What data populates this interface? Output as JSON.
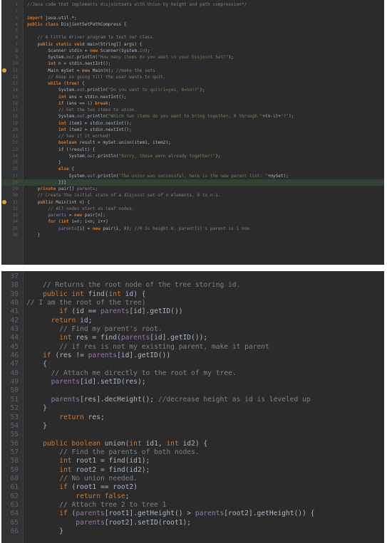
{
  "panels": [
    {
      "name": "editor-top",
      "lines": [
        {
          "n": "1",
          "tokens": [
            [
              "com",
              "//Java code that implements "
            ],
            [
              "com",
              "disjointsets"
            ],
            [
              "com",
              " with Union by height and path compression*/"
            ]
          ]
        },
        {
          "n": "2",
          "tokens": []
        },
        {
          "n": "3",
          "tokens": [
            [
              "kw",
              "import "
            ],
            [
              "cls",
              "java.util.*"
            ],
            [
              "cls",
              ";"
            ]
          ]
        },
        {
          "n": "4",
          "tokens": [
            [
              "kw",
              "public class "
            ],
            [
              "cls",
              "DisjiontSetPathCompress {"
            ]
          ]
        },
        {
          "n": "5",
          "tokens": []
        },
        {
          "n": "6",
          "tokens": [
            [
              "com",
              "    // A little driver program to test our class."
            ]
          ]
        },
        {
          "n": "7",
          "fold": true,
          "tokens": [
            [
              "kw",
              "    public static void "
            ],
            [
              "cls",
              "main(String[] args) {"
            ]
          ]
        },
        {
          "n": "8",
          "tokens": [
            [
              "cls",
              "        Scanner stdin = "
            ],
            [
              "kw",
              "new "
            ],
            [
              "cls",
              "Scanner(System."
            ],
            [
              "ital",
              "in"
            ],
            [
              "cls",
              ");"
            ]
          ]
        },
        {
          "n": "9",
          "tokens": [
            [
              "cls",
              "        System."
            ],
            [
              "ital",
              "out"
            ],
            [
              "cls",
              ".println("
            ],
            [
              "str",
              "\"How many items do you want in your Disjoint Set?\""
            ],
            [
              "cls",
              ");"
            ]
          ]
        },
        {
          "n": "10",
          "tokens": [
            [
              "kw",
              "        int "
            ],
            [
              "cls",
              "n = stdin.nextInt();"
            ]
          ]
        },
        {
          "n": "11",
          "dot": true,
          "tokens": [
            [
              "cls",
              "        Main mySet = "
            ],
            [
              "kw",
              "new "
            ],
            [
              "cls",
              "Main(n); "
            ],
            [
              "com",
              "//make the sets"
            ]
          ]
        },
        {
          "n": "12",
          "tokens": [
            [
              "com",
              "        // Keep on going till the user wants to quit."
            ]
          ]
        },
        {
          "n": "13",
          "tokens": [
            [
              "kw",
              "        while "
            ],
            [
              "cls",
              "("
            ],
            [
              "kw",
              "true"
            ],
            [
              "cls",
              ") {"
            ]
          ]
        },
        {
          "n": "14",
          "tokens": [
            [
              "cls",
              "            System."
            ],
            [
              "ital",
              "out"
            ],
            [
              "cls",
              ".println("
            ],
            [
              "str",
              "\"Do you want to quit(1=yes, 0=no)?\""
            ],
            [
              "cls",
              ");"
            ]
          ]
        },
        {
          "n": "15",
          "tokens": [
            [
              "kw",
              "            int "
            ],
            [
              "cls",
              "ans = stdin.nextInt();"
            ]
          ]
        },
        {
          "n": "16",
          "tokens": [
            [
              "kw",
              "            if "
            ],
            [
              "cls",
              "(ans == "
            ],
            [
              "num",
              "1"
            ],
            [
              "cls",
              ") "
            ],
            [
              "kw",
              "break"
            ],
            [
              "cls",
              ";"
            ]
          ]
        },
        {
          "n": "17",
          "tokens": [
            [
              "com",
              "            // Get the two items to union."
            ]
          ]
        },
        {
          "n": "18",
          "tokens": [
            [
              "cls",
              "            System."
            ],
            [
              "ital",
              "out"
            ],
            [
              "cls",
              ".println("
            ],
            [
              "str",
              "\"Which two items do you want to bring together, 0 through \""
            ],
            [
              "cls",
              "+(n-"
            ],
            [
              "num",
              "1"
            ],
            [
              "cls",
              ")+"
            ],
            [
              "str",
              "\"?\""
            ],
            [
              "cls",
              ");"
            ]
          ]
        },
        {
          "n": "19",
          "tokens": [
            [
              "kw",
              "            int "
            ],
            [
              "cls",
              "item1 = stdin.nextInt();"
            ]
          ]
        },
        {
          "n": "20",
          "tokens": [
            [
              "kw",
              "            int "
            ],
            [
              "cls",
              "item2 = stdin.nextInt();"
            ]
          ]
        },
        {
          "n": "21",
          "tokens": [
            [
              "com",
              "            // See if it worked!"
            ]
          ]
        },
        {
          "n": "22",
          "tokens": [
            [
              "kw",
              "            boolean "
            ],
            [
              "cls",
              "result = mySet.union(item1, item2);"
            ]
          ]
        },
        {
          "n": "23",
          "tokens": [
            [
              "kw",
              "            if "
            ],
            [
              "cls",
              "(!result) {"
            ]
          ]
        },
        {
          "n": "24",
          "tokens": [
            [
              "cls",
              "                System."
            ],
            [
              "ital",
              "out"
            ],
            [
              "cls",
              ".println("
            ],
            [
              "str",
              "\"Sorry, those were already together!\""
            ],
            [
              "cls",
              ");"
            ]
          ]
        },
        {
          "n": "25",
          "tokens": [
            [
              "cls",
              "            }"
            ]
          ]
        },
        {
          "n": "26",
          "tokens": [
            [
              "kw",
              "            else "
            ],
            [
              "cls",
              "{"
            ]
          ]
        },
        {
          "n": "27",
          "tokens": [
            [
              "cls",
              "                System."
            ],
            [
              "ital",
              "out"
            ],
            [
              "cls",
              ".println("
            ],
            [
              "str",
              "\"The union was successful, here is the new parent list: \""
            ],
            [
              "cls",
              "+mySet);"
            ]
          ]
        },
        {
          "n": "28",
          "hl": true,
          "tokens": [
            [
              "cls",
              "            }}}"
            ]
          ]
        },
        {
          "n": "29",
          "tokens": [
            [
              "kw",
              "    private "
            ],
            [
              "cls",
              "pair[] "
            ],
            [
              "fld",
              "parents"
            ],
            [
              "cls",
              ";"
            ]
          ]
        },
        {
          "n": "30",
          "tokens": [
            [
              "com",
              "    // Create the initial state of a disjoint set of n elements, 0 to n-1."
            ]
          ]
        },
        {
          "n": "31",
          "dot": true,
          "fold": true,
          "tokens": [
            [
              "kw",
              "    public "
            ],
            [
              "cls",
              "Main(int n) {"
            ]
          ]
        },
        {
          "n": "32",
          "tokens": [
            [
              "com",
              "        // All nodes start as leaf nodes."
            ]
          ]
        },
        {
          "n": "33",
          "tokens": [
            [
              "fld",
              "        parents "
            ],
            [
              "cls",
              "= "
            ],
            [
              "kw",
              "new "
            ],
            [
              "cls",
              "pair[n];"
            ]
          ]
        },
        {
          "n": "34",
          "tokens": [
            [
              "kw",
              "        for "
            ],
            [
              "cls",
              "("
            ],
            [
              "kw",
              "int "
            ],
            [
              "cls",
              "i="
            ],
            [
              "num",
              "0"
            ],
            [
              "cls",
              "; i<n; i++)"
            ]
          ]
        },
        {
          "n": "35",
          "tokens": [
            [
              "fld",
              "            parents"
            ],
            [
              "cls",
              "[i] = "
            ],
            [
              "kw",
              "new "
            ],
            [
              "cls",
              "pair(i, "
            ],
            [
              "num",
              "0"
            ],
            [
              "cls",
              "); "
            ],
            [
              "com",
              "//0 is height 0. parent[i]'s parent is i now"
            ]
          ]
        },
        {
          "n": "36",
          "tokens": [
            [
              "cls",
              "    }"
            ]
          ]
        }
      ]
    },
    {
      "name": "editor-bottom",
      "lines": [
        {
          "n": "37",
          "tokens": []
        },
        {
          "n": "38",
          "tokens": [
            [
              "com",
              "    // Returns the root node of the tree storing id."
            ]
          ]
        },
        {
          "n": "39",
          "fold": true,
          "tokens": [
            [
              "kw2",
              "    public int "
            ],
            [
              "cls",
              "find("
            ],
            [
              "kw2",
              "int "
            ],
            [
              "cls",
              "id) {"
            ]
          ]
        },
        {
          "n": "40",
          "tokens": [
            [
              "com",
              "// I am the root of the tree)"
            ]
          ]
        },
        {
          "n": "41",
          "tokens": [
            [
              "kw2",
              "        if "
            ],
            [
              "cls",
              "(id == "
            ],
            [
              "fld",
              "parents"
            ],
            [
              "cls",
              "[id].getID())"
            ]
          ]
        },
        {
          "n": "42",
          "tokens": [
            [
              "kw2",
              "      return "
            ],
            [
              "cls",
              "id;"
            ]
          ]
        },
        {
          "n": "43",
          "tokens": [
            [
              "com",
              "        // Find my parent's root."
            ]
          ]
        },
        {
          "n": "44",
          "tokens": [
            [
              "kw2",
              "        int "
            ],
            [
              "cls",
              "res = find("
            ],
            [
              "fld",
              "parents"
            ],
            [
              "cls",
              "[id].getID());"
            ]
          ]
        },
        {
          "n": "45",
          "tokens": [
            [
              "com",
              "        // if res is not "
            ],
            [
              "com",
              "my"
            ],
            [
              "com",
              " existing parent, make it parent"
            ]
          ]
        },
        {
          "n": "46",
          "tokens": [
            [
              "kw2",
              "    if "
            ],
            [
              "cls",
              "(res != "
            ],
            [
              "fld",
              "parents"
            ],
            [
              "cls",
              "[id].getID())"
            ]
          ]
        },
        {
          "n": "47",
          "tokens": [
            [
              "cls",
              "    {"
            ]
          ]
        },
        {
          "n": "48",
          "tokens": [
            [
              "com",
              "      // Attach me directly to the root of my tree."
            ]
          ]
        },
        {
          "n": "49",
          "tokens": [
            [
              "fld",
              "      parents"
            ],
            [
              "cls",
              "[id].setID(res);"
            ]
          ]
        },
        {
          "n": "50",
          "tokens": []
        },
        {
          "n": "51",
          "tokens": [
            [
              "fld",
              "      parents"
            ],
            [
              "cls",
              "[res].decHeight(); "
            ],
            [
              "com",
              "//decrease height as id is leveled up"
            ]
          ]
        },
        {
          "n": "52",
          "tokens": [
            [
              "cls",
              "    }"
            ]
          ]
        },
        {
          "n": "53",
          "tokens": [
            [
              "kw2",
              "        return "
            ],
            [
              "cls",
              "res;"
            ]
          ]
        },
        {
          "n": "54",
          "tokens": [
            [
              "cls",
              "    }"
            ]
          ]
        },
        {
          "n": "55",
          "tokens": []
        },
        {
          "n": "56",
          "fold": true,
          "tokens": [
            [
              "kw2",
              "    public boolean "
            ],
            [
              "cls",
              "union("
            ],
            [
              "kw2",
              "int "
            ],
            [
              "cls",
              "id1, "
            ],
            [
              "kw2",
              "int "
            ],
            [
              "cls",
              "id2) {"
            ]
          ]
        },
        {
          "n": "57",
          "tokens": [
            [
              "com",
              "        // Find the parents of both nodes."
            ]
          ]
        },
        {
          "n": "58",
          "tokens": [
            [
              "kw2",
              "        int "
            ],
            [
              "cls",
              "root1 = find(id1);"
            ]
          ]
        },
        {
          "n": "59",
          "tokens": [
            [
              "kw2",
              "        int "
            ],
            [
              "cls",
              "root2 = find(id2);"
            ]
          ]
        },
        {
          "n": "60",
          "tokens": [
            [
              "com",
              "        // No union needed."
            ]
          ]
        },
        {
          "n": "61",
          "tokens": [
            [
              "kw2",
              "        if "
            ],
            [
              "cls",
              "(root1 == root2)"
            ]
          ]
        },
        {
          "n": "62",
          "tokens": [
            [
              "kw2",
              "            return false"
            ],
            [
              "cls",
              ";"
            ]
          ]
        },
        {
          "n": "63",
          "tokens": [
            [
              "com",
              "        // Attach tree 2 to tree 1"
            ]
          ]
        },
        {
          "n": "64",
          "tokens": [
            [
              "kw2",
              "        if "
            ],
            [
              "cls",
              "("
            ],
            [
              "fld",
              "parents"
            ],
            [
              "cls",
              "[root1].getHeight() > "
            ],
            [
              "fld",
              "parents"
            ],
            [
              "cls",
              "[root2].getHeight()) {"
            ]
          ]
        },
        {
          "n": "65",
          "tokens": [
            [
              "fld",
              "            parents"
            ],
            [
              "cls",
              "[root2].setID(root1);"
            ]
          ]
        },
        {
          "n": "66",
          "tokens": [
            [
              "cls",
              "        }"
            ]
          ]
        }
      ]
    }
  ],
  "colors": {
    "bg": "#2b2b2b",
    "gutter": "#313335",
    "keyword": "#cc7832",
    "string": "#6a8759",
    "comment": "#808080",
    "field": "#9876aa",
    "number": "#6897bb",
    "text": "#a9b7c6"
  }
}
